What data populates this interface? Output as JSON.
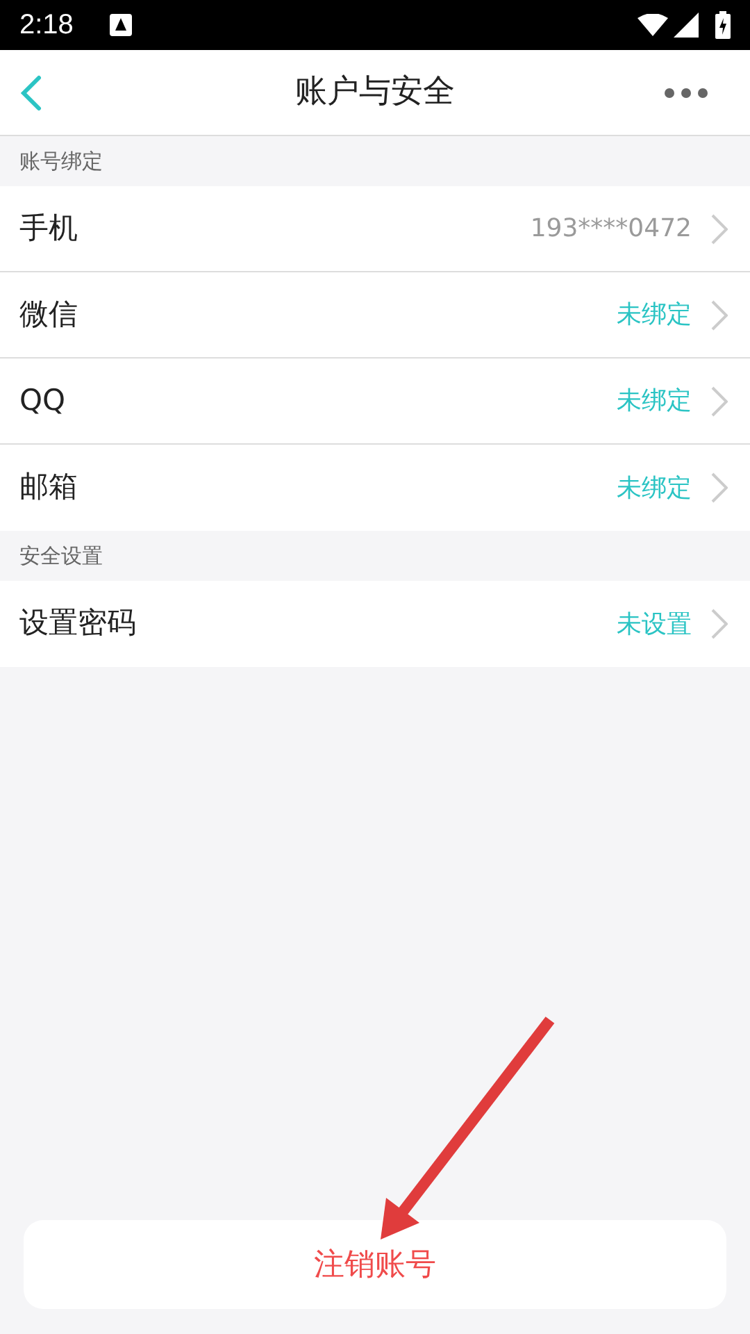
{
  "status_bar": {
    "time": "2:18"
  },
  "header": {
    "title": "账户与安全"
  },
  "sections": [
    {
      "title": "账号绑定",
      "rows": [
        {
          "label": "手机",
          "value": "193****0472",
          "kind": "info"
        },
        {
          "label": "微信",
          "value": "未绑定",
          "kind": "status"
        },
        {
          "label": "QQ",
          "value": "未绑定",
          "kind": "status"
        },
        {
          "label": "邮箱",
          "value": "未绑定",
          "kind": "status"
        }
      ]
    },
    {
      "title": "安全设置",
      "rows": [
        {
          "label": "设置密码",
          "value": "未设置",
          "kind": "status"
        }
      ]
    }
  ],
  "footer": {
    "button": "注销账号"
  }
}
